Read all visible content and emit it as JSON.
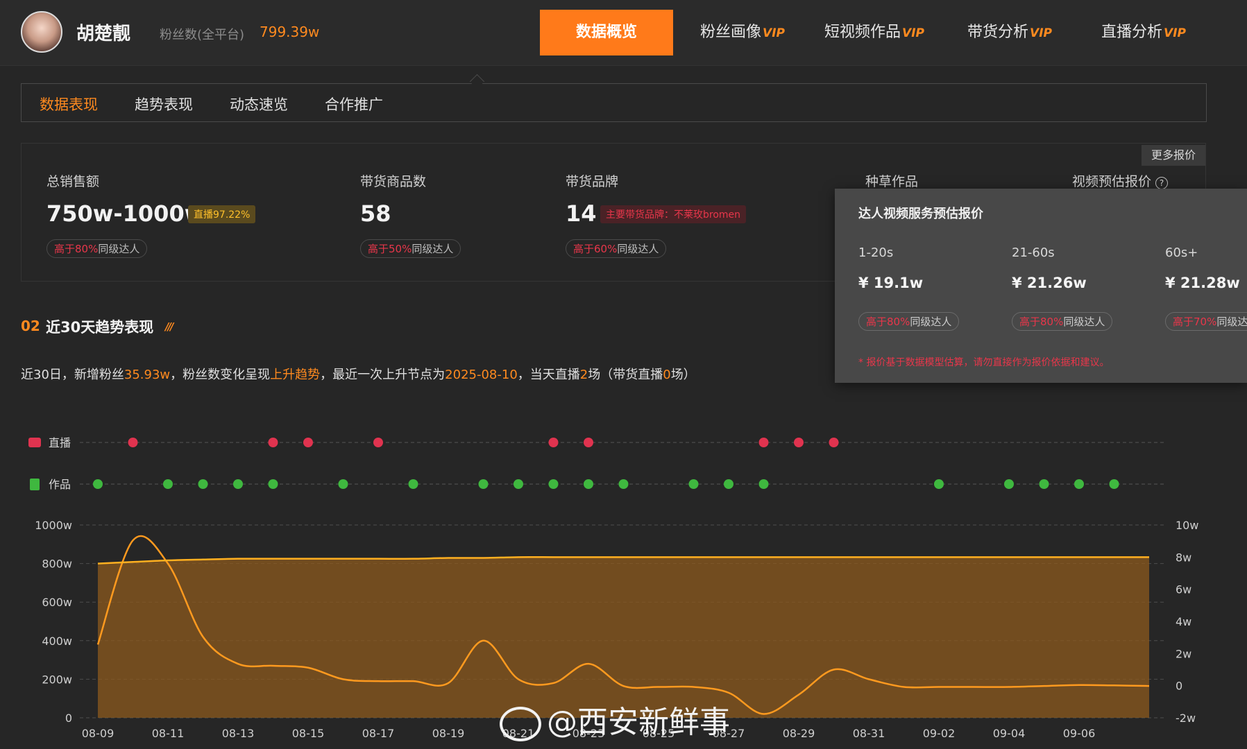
{
  "header": {
    "username": "胡楚靓",
    "fans_label": "粉丝数(全平台)",
    "fans_value": "799.39w",
    "nav": [
      {
        "label": "数据概览",
        "vip": ""
      },
      {
        "label": "粉丝画像",
        "vip": "VIP"
      },
      {
        "label": "短视频作品",
        "vip": "VIP"
      },
      {
        "label": "带货分析",
        "vip": "VIP"
      },
      {
        "label": "直播分析",
        "vip": "VIP"
      }
    ]
  },
  "subtabs": [
    "数据表现",
    "趋势表现",
    "动态速览",
    "合作推广"
  ],
  "metrics": {
    "sales": {
      "label": "总销售额",
      "value": "750w-1000w",
      "badge": "直播97.22%",
      "pill_hi": "高于80%",
      "pill_rest": "同级达人"
    },
    "goods": {
      "label": "带货商品数",
      "value": "58",
      "pill_hi": "高于50%",
      "pill_rest": "同级达人"
    },
    "brands": {
      "label": "带货品牌",
      "value": "14",
      "badge": "主要带货品牌：不莱玫bromen",
      "pill_hi": "高于60%",
      "pill_rest": "同级达人"
    },
    "seeding": {
      "label": "种草作品"
    },
    "video_quote": {
      "label": "视频预估报价"
    },
    "more_quote": "更多报价"
  },
  "popup": {
    "title": "达人视频服务预估报价",
    "columns": [
      {
        "duration": "1-20s",
        "price": "¥ 19.1w",
        "pill_hi": "高于80%",
        "pill_rest": "同级达人"
      },
      {
        "duration": "21-60s",
        "price": "¥ 21.26w",
        "pill_hi": "高于80%",
        "pill_rest": "同级达人"
      },
      {
        "duration": "60s+",
        "price": "¥ 21.28w",
        "pill_hi": "高于70%",
        "pill_rest": "同级达人"
      }
    ],
    "note": "* 报价基于数据模型估算，请勿直接作为报价依据和建议。"
  },
  "trend": {
    "section_num": "02",
    "section_title": "近30天趋势表现",
    "summary": {
      "p1": "近30日，新增粉丝",
      "fans": "35.93w",
      "p2": "，粉丝数变化呈现",
      "trend": "上升趋势",
      "p3": "，最近一次上升节点为",
      "date": "2025-08-10",
      "p4": "，当天直播",
      "live": "2",
      "p5": "场（带货直播",
      "live_goods": "0",
      "p6": "场）"
    }
  },
  "chart_data": {
    "type": "area",
    "rows": {
      "live_label": "直播",
      "works_label": "作品"
    },
    "live_color": "#e0334f",
    "works_color": "#3fb83f",
    "x_labels": [
      "08-09",
      "08-11",
      "08-13",
      "08-15",
      "08-17",
      "08-19",
      "08-21",
      "08-23",
      "08-25",
      "08-27",
      "08-29",
      "08-31",
      "09-02",
      "09-04",
      "09-06"
    ],
    "live_days": [
      1,
      5,
      6,
      8,
      13,
      14,
      19,
      20,
      21
    ],
    "works_days": [
      0,
      2,
      3,
      4,
      5,
      7,
      9,
      11,
      12,
      13,
      14,
      15,
      17,
      18,
      19,
      24,
      26,
      27,
      28,
      29
    ],
    "y_left_ticks": [
      "0",
      "200w",
      "400w",
      "600w",
      "800w",
      "1000w"
    ],
    "y_left_range": [
      0,
      1000
    ],
    "y_right_ticks": [
      "-2w",
      "0",
      "2w",
      "4w",
      "6w",
      "8w",
      "10w"
    ],
    "y_right_range": [
      -2,
      10
    ],
    "sales_series": [
      380,
      920,
      800,
      420,
      280,
      270,
      260,
      200,
      190,
      190,
      180,
      400,
      200,
      180,
      280,
      165,
      160,
      160,
      130,
      20,
      120,
      250,
      200,
      160,
      160,
      160,
      160,
      165,
      170,
      168,
      165
    ],
    "fans_series": [
      7.6,
      7.7,
      7.8,
      7.85,
      7.9,
      7.9,
      7.9,
      7.9,
      7.9,
      7.9,
      7.95,
      7.95,
      8.0,
      8.0,
      8.0,
      8.0,
      8.0,
      8.0,
      8.0,
      8.0,
      8.0,
      8.0,
      8.0,
      8.0,
      8.0,
      8.0,
      8.0,
      8.0,
      8.0,
      8.0,
      8.0
    ],
    "line_color": "#ff9a1f"
  },
  "watermark": "@西安新鲜事"
}
